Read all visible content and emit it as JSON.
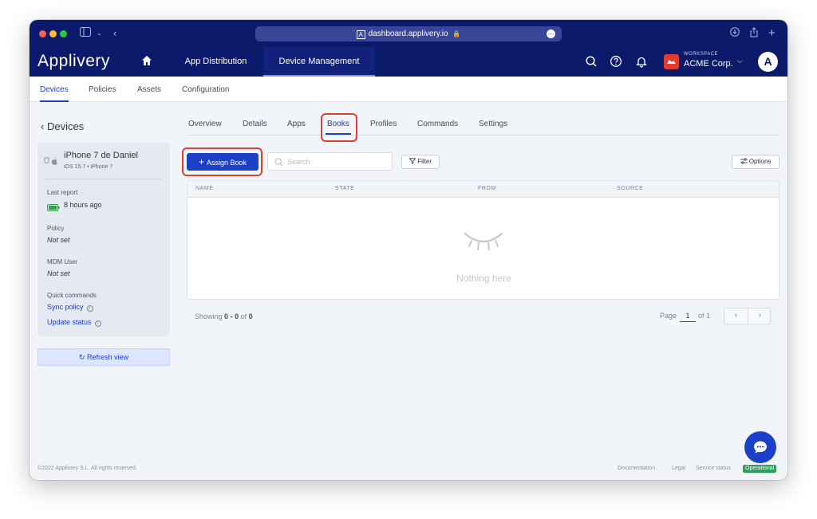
{
  "browser": {
    "url": "dashboard.applivery.io",
    "site_logo": "A"
  },
  "header": {
    "brand": "Applivery",
    "nav": [
      "App Distribution",
      "Device Management"
    ],
    "workspace_label": "WORKSPACE",
    "workspace_name": "ACME Corp.",
    "avatar_letter": "A"
  },
  "subnav": [
    "Devices",
    "Policies",
    "Assets",
    "Configuration"
  ],
  "sidebar": {
    "back_label": "Devices",
    "device_name": "iPhone 7 de Daniel",
    "device_sub": "iOS 15.7 • iPhone 7",
    "last_report_label": "Last report",
    "last_report_value": "8 hours ago",
    "policy_label": "Policy",
    "policy_value": "Not set",
    "mdm_user_label": "MDM User",
    "mdm_user_value": "Not set",
    "quick_commands_label": "Quick commands",
    "sync_policy": "Sync policy",
    "update_status": "Update status",
    "refresh_label": "Refresh view"
  },
  "tabs": [
    "Overview",
    "Details",
    "Apps",
    "Books",
    "Profiles",
    "Commands",
    "Settings"
  ],
  "toolbar": {
    "assign_label": "Assign Book",
    "search_placeholder": "Search",
    "filter_label": "Filter",
    "options_label": "Options"
  },
  "table": {
    "columns": [
      "NAME",
      "STATE",
      "FROM",
      "SOURCE"
    ],
    "empty_text": "Nothing here"
  },
  "pagination": {
    "showing_prefix": "Showing",
    "from": "0",
    "dash": "-",
    "to": "0",
    "of_word": "of",
    "total": "0",
    "page_label": "Page",
    "page": "1",
    "of_pages": "of 1"
  },
  "footer": {
    "copyright": "©2022 Applivery S.L. All rights reserved.",
    "links": [
      "Documentation",
      "Legal",
      "Service status"
    ],
    "status": "Operational"
  },
  "colors": {
    "header_bg": "#0c1a6b",
    "accent": "#1d40c8",
    "highlight": "#d8432f",
    "status_green": "#2e9e5b"
  }
}
